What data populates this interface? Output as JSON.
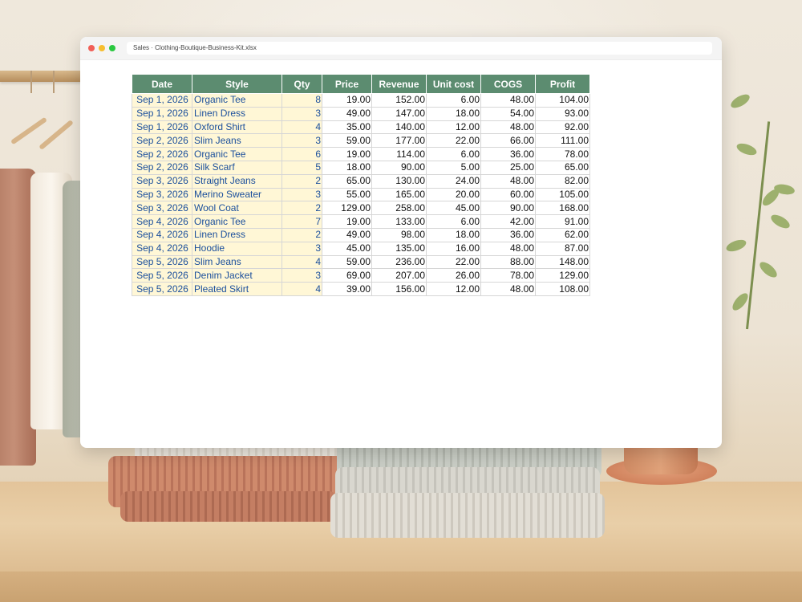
{
  "window": {
    "address": "Sales · Clothing-Boutique-Business-Kit.xlsx"
  },
  "sheet": {
    "headers": [
      "Date",
      "Style",
      "Qty",
      "Price",
      "Revenue",
      "Unit cost",
      "COGS",
      "Profit"
    ],
    "rows": [
      [
        "Sep 1, 2026",
        "Organic Tee",
        "8",
        "19.00",
        "152.00",
        "6.00",
        "48.00",
        "104.00"
      ],
      [
        "Sep 1, 2026",
        "Linen Dress",
        "3",
        "49.00",
        "147.00",
        "18.00",
        "54.00",
        "93.00"
      ],
      [
        "Sep 1, 2026",
        "Oxford Shirt",
        "4",
        "35.00",
        "140.00",
        "12.00",
        "48.00",
        "92.00"
      ],
      [
        "Sep 2, 2026",
        "Slim Jeans",
        "3",
        "59.00",
        "177.00",
        "22.00",
        "66.00",
        "111.00"
      ],
      [
        "Sep 2, 2026",
        "Organic Tee",
        "6",
        "19.00",
        "114.00",
        "6.00",
        "36.00",
        "78.00"
      ],
      [
        "Sep 2, 2026",
        "Silk Scarf",
        "5",
        "18.00",
        "90.00",
        "5.00",
        "25.00",
        "65.00"
      ],
      [
        "Sep 3, 2026",
        "Straight Jeans",
        "2",
        "65.00",
        "130.00",
        "24.00",
        "48.00",
        "82.00"
      ],
      [
        "Sep 3, 2026",
        "Merino Sweater",
        "3",
        "55.00",
        "165.00",
        "20.00",
        "60.00",
        "105.00"
      ],
      [
        "Sep 3, 2026",
        "Wool Coat",
        "2",
        "129.00",
        "258.00",
        "45.00",
        "90.00",
        "168.00"
      ],
      [
        "Sep 4, 2026",
        "Organic Tee",
        "7",
        "19.00",
        "133.00",
        "6.00",
        "42.00",
        "91.00"
      ],
      [
        "Sep 4, 2026",
        "Linen Dress",
        "2",
        "49.00",
        "98.00",
        "18.00",
        "36.00",
        "62.00"
      ],
      [
        "Sep 4, 2026",
        "Hoodie",
        "3",
        "45.00",
        "135.00",
        "16.00",
        "48.00",
        "87.00"
      ],
      [
        "Sep 5, 2026",
        "Slim Jeans",
        "4",
        "59.00",
        "236.00",
        "22.00",
        "88.00",
        "148.00"
      ],
      [
        "Sep 5, 2026",
        "Denim Jacket",
        "3",
        "69.00",
        "207.00",
        "26.00",
        "78.00",
        "129.00"
      ],
      [
        "Sep 5, 2026",
        "Pleated Skirt",
        "4",
        "39.00",
        "156.00",
        "12.00",
        "48.00",
        "108.00"
      ]
    ]
  },
  "colors": {
    "header_bg": "#5c8c70",
    "input_bg": "#fff7d6",
    "input_text": "#1b4f9c"
  }
}
